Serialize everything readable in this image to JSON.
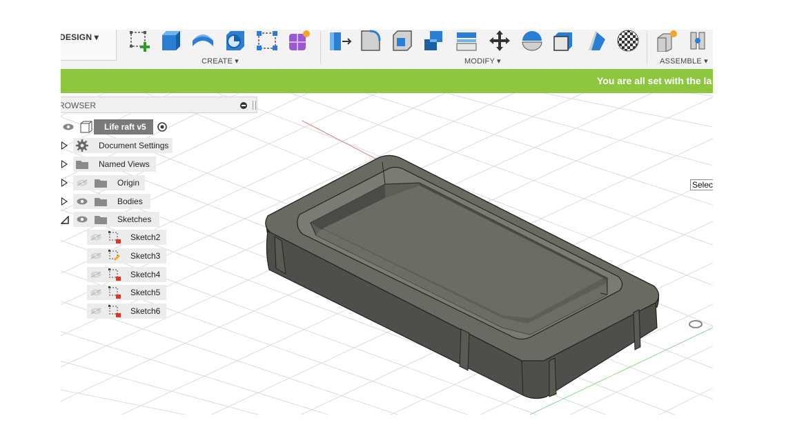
{
  "toolbar": {
    "workspace_label": "DESIGN ▾",
    "create_label": "CREATE ▾",
    "modify_label": "MODIFY ▾",
    "assemble_label": "ASSEMBLE ▾",
    "icons": {
      "create": [
        "create-sketch-icon",
        "extrude-icon",
        "revolve-icon",
        "hole-icon",
        "rectangular-pattern-icon",
        "create-form-icon"
      ],
      "modify": [
        "press-pull-icon",
        "fillet-icon",
        "shell-icon",
        "combine-icon",
        "replace-face-icon",
        "move-copy-icon",
        "split-body-icon",
        "scale-icon",
        "draft-icon",
        "appearance-icon"
      ],
      "assemble": [
        "new-component-icon",
        "joint-icon"
      ]
    }
  },
  "banner": {
    "text": "You are all set with the la",
    "color": "#8dc63f"
  },
  "browser": {
    "title": "ROWSER",
    "root": {
      "label": "Life raft v5"
    },
    "items": [
      {
        "label": "Document Settings",
        "icon": "gear-icon"
      },
      {
        "label": "Named Views",
        "icon": "folder-icon"
      },
      {
        "label": "Origin",
        "icon": "folder-icon"
      },
      {
        "label": "Bodies",
        "icon": "folder-icon"
      },
      {
        "label": "Sketches",
        "icon": "folder-icon"
      }
    ],
    "sketches": [
      {
        "label": "Sketch2"
      },
      {
        "label": "Sketch3"
      },
      {
        "label": "Sketch4"
      },
      {
        "label": "Sketch5"
      },
      {
        "label": "Sketch6"
      }
    ]
  },
  "viewport": {
    "selection_box": "Select",
    "body_color": "#6b6a61",
    "grid_color": "#dcdcdc"
  }
}
